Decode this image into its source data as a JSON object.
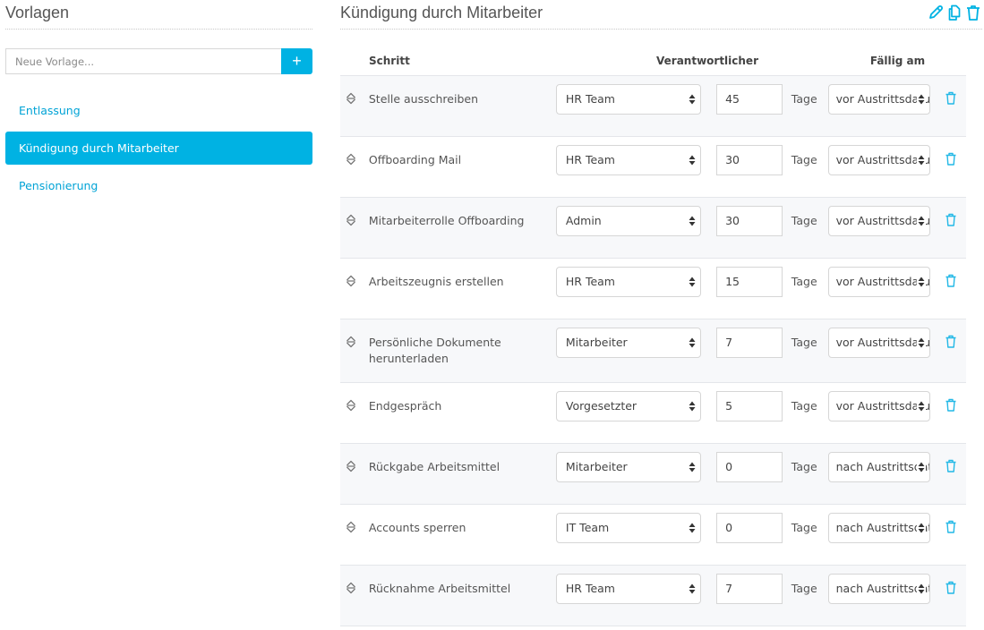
{
  "sidebar": {
    "title": "Vorlagen",
    "new_template_placeholder": "Neue Vorlage...",
    "add_button_label": "+",
    "templates": [
      {
        "label": "Entlassung",
        "active": false
      },
      {
        "label": "Kündigung durch Mitarbeiter",
        "active": true
      },
      {
        "label": "Pensionierung",
        "active": false
      }
    ]
  },
  "main": {
    "title": "Kündigung durch Mitarbeiter",
    "actions": [
      {
        "icon": "pencil-icon",
        "label": "Bearbeiten"
      },
      {
        "icon": "copy-icon",
        "label": "Kopieren"
      },
      {
        "icon": "trash-icon",
        "label": "Löschen"
      }
    ],
    "columns": {
      "step": "Schritt",
      "responsible": "Verantwortlicher",
      "due": "Fällig am"
    },
    "unit_label": "Tage",
    "steps": [
      {
        "name": "Stelle ausschreiben",
        "responsible": "HR Team",
        "days": "45",
        "relation": "vor Austrittsdatum"
      },
      {
        "name": "Offboarding Mail",
        "responsible": "HR Team",
        "days": "30",
        "relation": "vor Austrittsdatum"
      },
      {
        "name": "Mitarbeiterrolle Offboarding",
        "responsible": "Admin",
        "days": "30",
        "relation": "vor Austrittsdatum"
      },
      {
        "name": "Arbeitszeugnis erstellen",
        "responsible": "HR Team",
        "days": "15",
        "relation": "vor Austrittsdatum"
      },
      {
        "name": "Persönliche Dokumente herunterladen",
        "responsible": "Mitarbeiter",
        "days": "7",
        "relation": "vor Austrittsdatum"
      },
      {
        "name": "Endgespräch",
        "responsible": "Vorgesetzter",
        "days": "5",
        "relation": "vor Austrittsdatum"
      },
      {
        "name": "Rückgabe Arbeitsmittel",
        "responsible": "Mitarbeiter",
        "days": "0",
        "relation": "nach Austrittsdatum"
      },
      {
        "name": "Accounts sperren",
        "responsible": "IT Team",
        "days": "0",
        "relation": "nach Austrittsdatum"
      },
      {
        "name": "Rücknahme Arbeitsmittel",
        "responsible": "HR Team",
        "days": "7",
        "relation": "nach Austrittsdatum"
      }
    ]
  },
  "colors": {
    "accent": "#00b2e3",
    "link": "#00a3d6",
    "row_alt": "#f7f8fa"
  }
}
